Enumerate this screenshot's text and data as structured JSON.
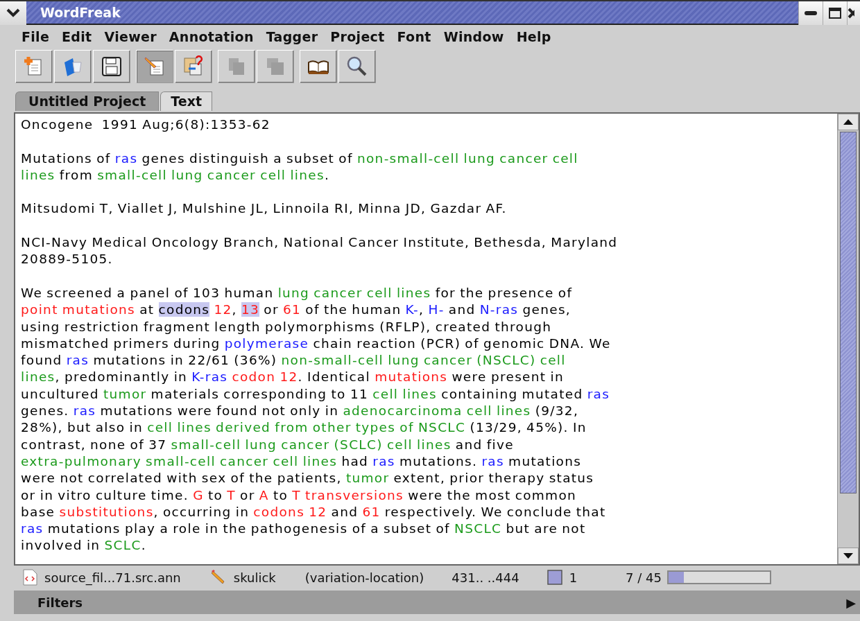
{
  "window": {
    "title": "WordFreak"
  },
  "menu": [
    {
      "label": "File"
    },
    {
      "label": "Edit"
    },
    {
      "label": "Viewer"
    },
    {
      "label": "Annotation"
    },
    {
      "label": "Tagger"
    },
    {
      "label": "Project"
    },
    {
      "label": "Font"
    },
    {
      "label": "Window"
    },
    {
      "label": "Help"
    }
  ],
  "toolbar": [
    [
      {
        "kind": "new",
        "pressed": false,
        "disabled": false
      },
      {
        "kind": "open",
        "pressed": false,
        "disabled": false
      },
      {
        "kind": "save",
        "pressed": false,
        "disabled": false
      }
    ],
    [
      {
        "kind": "annotate",
        "pressed": true,
        "disabled": false
      },
      {
        "kind": "query",
        "pressed": false,
        "disabled": false
      }
    ],
    [
      {
        "kind": "copy",
        "pressed": false,
        "disabled": true
      },
      {
        "kind": "paste",
        "pressed": false,
        "disabled": true
      }
    ],
    [
      {
        "kind": "book",
        "pressed": false,
        "disabled": false
      },
      {
        "kind": "search",
        "pressed": false,
        "disabled": false
      }
    ]
  ],
  "tabs": [
    {
      "label": "Untitled Project",
      "selected": false
    },
    {
      "label": "Text",
      "selected": true
    }
  ],
  "document": {
    "paragraphs": [
      {
        "lines": [
          [
            {
              "text": "Oncogene  1991 Aug;6(8):1353-62",
              "selected": false
            }
          ]
        ]
      },
      {
        "lines": [
          [
            {
              "text": "Mutations of ",
              "selected": false
            },
            {
              "text": "ras",
              "color": "#1a1aff",
              "selected": false
            },
            {
              "text": " genes distinguish a subset of ",
              "selected": false
            },
            {
              "text": "non-small-cell lung cancer cell",
              "color": "#1b9a1b",
              "selected": false
            }
          ],
          [
            {
              "text": "lines",
              "color": "#1b9a1b",
              "selected": false
            },
            {
              "text": " from ",
              "selected": false
            },
            {
              "text": "small-cell lung cancer cell lines",
              "color": "#1b9a1b",
              "selected": false
            },
            {
              "text": ".",
              "selected": false
            }
          ]
        ]
      },
      {
        "lines": [
          [
            {
              "text": "Mitsudomi T, Viallet J, Mulshine JL, Linnoila RI, Minna JD, Gazdar AF.",
              "selected": false
            }
          ]
        ]
      },
      {
        "lines": [
          [
            {
              "text": "NCI-Navy Medical Oncology Branch, National Cancer Institute, Bethesda, Maryland",
              "selected": false
            }
          ],
          [
            {
              "text": "20889-5105.",
              "selected": false
            }
          ]
        ]
      },
      {
        "lines": [
          [
            {
              "text": "We screened a panel of 103 human ",
              "selected": false
            },
            {
              "text": "lung cancer cell lines",
              "color": "#1b9a1b",
              "selected": false
            },
            {
              "text": " for the presence of",
              "selected": false
            }
          ],
          [
            {
              "text": "point mutations",
              "color": "#ff1a1a",
              "selected": false
            },
            {
              "text": " at ",
              "selected": false
            },
            {
              "text": "codons",
              "selected": true
            },
            {
              "text": " 12",
              "color": "#ff1a1a",
              "selected": false
            },
            {
              "text": ", ",
              "selected": false
            },
            {
              "text": "13",
              "color": "#ff1a1a",
              "selected": true
            },
            {
              "text": " or ",
              "selected": false
            },
            {
              "text": "61",
              "color": "#ff1a1a",
              "selected": false
            },
            {
              "text": " of the human ",
              "selected": false
            },
            {
              "text": "K-",
              "color": "#1a1aff",
              "selected": false
            },
            {
              "text": ", ",
              "selected": false
            },
            {
              "text": "H-",
              "color": "#1a1aff",
              "selected": false
            },
            {
              "text": " and ",
              "selected": false
            },
            {
              "text": "N-ras",
              "color": "#1a1aff",
              "selected": false
            },
            {
              "text": " genes,",
              "selected": false
            }
          ],
          [
            {
              "text": "using restriction fragment length polymorphisms (RFLP), created through",
              "selected": false
            }
          ],
          [
            {
              "text": "mismatched primers during ",
              "selected": false
            },
            {
              "text": "polymerase",
              "color": "#1a1aff",
              "selected": false
            },
            {
              "text": " chain reaction (PCR) of genomic DNA. We",
              "selected": false
            }
          ],
          [
            {
              "text": "found ",
              "selected": false
            },
            {
              "text": "ras",
              "color": "#1a1aff",
              "selected": false
            },
            {
              "text": " mutations in 22/61 (36%) ",
              "selected": false
            },
            {
              "text": "non-small-cell lung cancer (NSCLC) cell",
              "color": "#1b9a1b",
              "selected": false
            }
          ],
          [
            {
              "text": "lines",
              "color": "#1b9a1b",
              "selected": false
            },
            {
              "text": ", predominantly in ",
              "selected": false
            },
            {
              "text": "K-ras",
              "color": "#1a1aff",
              "selected": false
            },
            {
              "text": " codon 12",
              "color": "#ff1a1a",
              "selected": false
            },
            {
              "text": ". Identical ",
              "selected": false
            },
            {
              "text": "mutations",
              "color": "#ff1a1a",
              "selected": false
            },
            {
              "text": " were present in",
              "selected": false
            }
          ],
          [
            {
              "text": "uncultured ",
              "selected": false
            },
            {
              "text": "tumor",
              "color": "#1b9a1b",
              "selected": false
            },
            {
              "text": " materials corresponding to 11 ",
              "selected": false
            },
            {
              "text": "cell lines",
              "color": "#1b9a1b",
              "selected": false
            },
            {
              "text": " containing mutated ",
              "selected": false
            },
            {
              "text": "ras",
              "color": "#1a1aff",
              "selected": false
            }
          ],
          [
            {
              "text": "genes. ",
              "selected": false
            },
            {
              "text": "ras",
              "color": "#1a1aff",
              "selected": false
            },
            {
              "text": " mutations were found not only in ",
              "selected": false
            },
            {
              "text": "adenocarcinoma cell lines",
              "color": "#1b9a1b",
              "selected": false
            },
            {
              "text": " (9/32,",
              "selected": false
            }
          ],
          [
            {
              "text": "28%), but also in ",
              "selected": false
            },
            {
              "text": "cell lines derived from other types of NSCLC",
              "color": "#1b9a1b",
              "selected": false
            },
            {
              "text": " (13/29, 45%). In",
              "selected": false
            }
          ],
          [
            {
              "text": "contrast, none of 37 ",
              "selected": false
            },
            {
              "text": "small-cell lung cancer (SCLC) cell lines",
              "color": "#1b9a1b",
              "selected": false
            },
            {
              "text": " and five",
              "selected": false
            }
          ],
          [
            {
              "text": "extra-pulmonary small-cell cancer cell lines",
              "color": "#1b9a1b",
              "selected": false
            },
            {
              "text": " had ",
              "selected": false
            },
            {
              "text": "ras",
              "color": "#1a1aff",
              "selected": false
            },
            {
              "text": " mutations. ",
              "selected": false
            },
            {
              "text": "ras",
              "color": "#1a1aff",
              "selected": false
            },
            {
              "text": " mutations",
              "selected": false
            }
          ],
          [
            {
              "text": "were not correlated with sex of the patients, ",
              "selected": false
            },
            {
              "text": "tumor",
              "color": "#1b9a1b",
              "selected": false
            },
            {
              "text": " extent, prior therapy status",
              "selected": false
            }
          ],
          [
            {
              "text": "or in vitro culture time. ",
              "selected": false
            },
            {
              "text": "G",
              "color": "#ff1a1a",
              "selected": false
            },
            {
              "text": " to ",
              "selected": false
            },
            {
              "text": "T",
              "color": "#ff1a1a",
              "selected": false
            },
            {
              "text": " or ",
              "selected": false
            },
            {
              "text": "A",
              "color": "#ff1a1a",
              "selected": false
            },
            {
              "text": " to ",
              "selected": false
            },
            {
              "text": "T transversions",
              "color": "#ff1a1a",
              "selected": false
            },
            {
              "text": " were the most common",
              "selected": false
            }
          ],
          [
            {
              "text": "base ",
              "selected": false
            },
            {
              "text": "substitutions",
              "color": "#ff1a1a",
              "selected": false
            },
            {
              "text": ", occurring in ",
              "selected": false
            },
            {
              "text": "codons 12",
              "color": "#ff1a1a",
              "selected": false
            },
            {
              "text": " and ",
              "selected": false
            },
            {
              "text": "61",
              "color": "#ff1a1a",
              "selected": false
            },
            {
              "text": " respectively. We conclude that",
              "selected": false
            }
          ],
          [
            {
              "text": "ras",
              "color": "#1a1aff",
              "selected": false
            },
            {
              "text": " mutations play a role in the pathogenesis of a subset of ",
              "selected": false
            },
            {
              "text": "NSCLC",
              "color": "#1b9a1b",
              "selected": false
            },
            {
              "text": " but are not",
              "selected": false
            }
          ],
          [
            {
              "text": "involved in ",
              "selected": false
            },
            {
              "text": "SCLC",
              "color": "#1b9a1b",
              "selected": false
            },
            {
              "text": ".",
              "selected": false
            }
          ]
        ]
      }
    ]
  },
  "status_bar": {
    "file": "source_fil...71.src.ann",
    "user": "skulick",
    "annotation_type": "(variation-location)",
    "span": "431.. ..444",
    "count": "1",
    "position": "7 / 45",
    "level": 0.15
  },
  "filters": {
    "label": "Filters",
    "expand_icon": "▶"
  }
}
